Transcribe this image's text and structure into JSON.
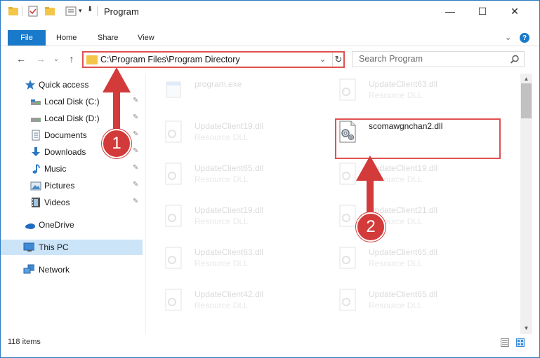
{
  "window": {
    "title": "Program",
    "controls": {
      "minimize": "—",
      "maximize": "☐",
      "close": "✕"
    }
  },
  "ribbon": {
    "tabs": [
      {
        "label": "File"
      },
      {
        "label": "Home"
      },
      {
        "label": "Share"
      },
      {
        "label": "View"
      }
    ],
    "expand_glyph": "⌄",
    "help_glyph": "?"
  },
  "nav": {
    "back": "←",
    "forward": "→",
    "recent": "⌄",
    "up": "↑",
    "address": "C:\\Program Files\\Program Directory",
    "address_chevron": "⌄",
    "refresh": "↻",
    "search_placeholder": "Search Program"
  },
  "sidebar": {
    "items": [
      {
        "label": "Quick access",
        "icon": "star-icon",
        "pinned": false
      },
      {
        "label": "Local Disk (C:)",
        "icon": "drive-icon",
        "pinned": true
      },
      {
        "label": "Local Disk (D:)",
        "icon": "drive-icon",
        "pinned": true
      },
      {
        "label": "Documents",
        "icon": "documents-icon",
        "pinned": true
      },
      {
        "label": "Downloads",
        "icon": "downloads-icon",
        "pinned": true
      },
      {
        "label": "Music",
        "icon": "music-icon",
        "pinned": true
      },
      {
        "label": "Pictures",
        "icon": "pictures-icon",
        "pinned": true
      },
      {
        "label": "Videos",
        "icon": "videos-icon",
        "pinned": true
      },
      {
        "label": "OneDrive",
        "icon": "onedrive-icon",
        "pinned": false
      },
      {
        "label": "This PC",
        "icon": "this-pc-icon",
        "pinned": false,
        "selected": true
      },
      {
        "label": "Network",
        "icon": "network-icon",
        "pinned": false
      }
    ],
    "pin_glyph": "📌"
  },
  "files": [
    {
      "name": "program.exe",
      "type": "",
      "highlight": false
    },
    {
      "name": "UpdateClient63.dll",
      "type": "Resource DLL",
      "highlight": false
    },
    {
      "name": "UpdateClient19.dll",
      "type": "Resource DLL",
      "highlight": false
    },
    {
      "name": "scomawgnchan2.dll",
      "type": "",
      "highlight": true
    },
    {
      "name": "UpdateClient65.dll",
      "type": "Resource DLL",
      "highlight": false
    },
    {
      "name": "UpdateClient19.dll",
      "type": "Resource DLL",
      "highlight": false
    },
    {
      "name": "UpdateClient19.dll",
      "type": "Resource DLL",
      "highlight": false
    },
    {
      "name": "UpdateClient21.dll",
      "type": "Resource DLL",
      "highlight": false
    },
    {
      "name": "UpdateClient63.dll",
      "type": "Resource DLL",
      "highlight": false
    },
    {
      "name": "UpdateClient65.dll",
      "type": "Resource DLL",
      "highlight": false
    },
    {
      "name": "UpdateClient42.dll",
      "type": "Resource DLL",
      "highlight": false
    },
    {
      "name": "UpdateClient65.dll",
      "type": "Resource DLL",
      "highlight": false
    }
  ],
  "status": {
    "item_count": "118 items"
  },
  "annotations": [
    {
      "label": "1"
    },
    {
      "label": "2"
    }
  ],
  "colors": {
    "accent": "#1979ca",
    "annotation": "#d33a3a",
    "selection": "#cce4f7",
    "folder": "#f3c64a"
  }
}
